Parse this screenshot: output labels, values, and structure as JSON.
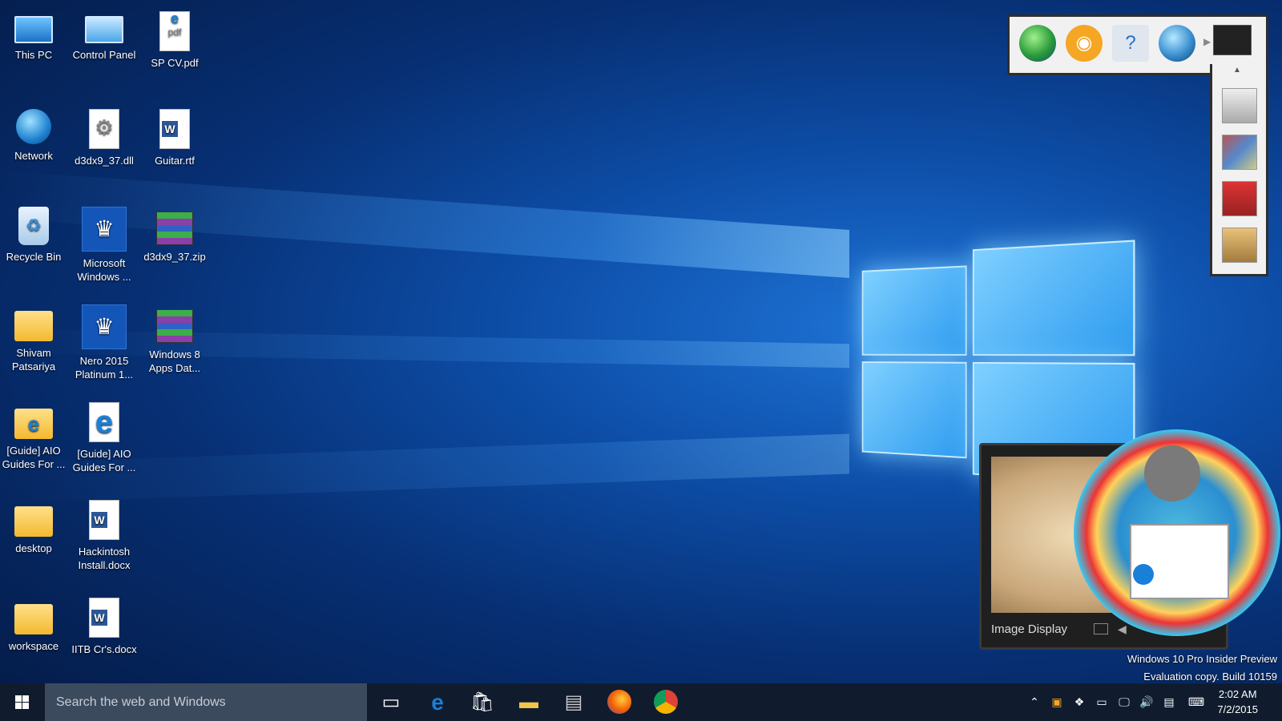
{
  "desktop": {
    "icons": [
      {
        "label": "This PC"
      },
      {
        "label": "Control Panel"
      },
      {
        "label": "SP CV.pdf"
      },
      {
        "label": "Network"
      },
      {
        "label": "d3dx9_37.dll"
      },
      {
        "label": "Guitar.rtf"
      },
      {
        "label": "Recycle Bin"
      },
      {
        "label": "Microsoft Windows ..."
      },
      {
        "label": "d3dx9_37.zip"
      },
      {
        "label": "Shivam Patsariya"
      },
      {
        "label": "Nero 2015 Platinum 1..."
      },
      {
        "label": "Windows 8 Apps Dat..."
      },
      {
        "label": "[Guide] AIO Guides For ..."
      },
      {
        "label": "[Guide] AIO Guides For ..."
      },
      {
        "label": "desktop"
      },
      {
        "label": "Hackintosh Install.docx"
      },
      {
        "label": "workspace"
      },
      {
        "label": "IITB Cr's.docx"
      }
    ]
  },
  "gadget": {
    "image_display_caption": "Image Display"
  },
  "watermark": {
    "line1": "Windows 10 Pro Insider Preview",
    "line2": "Evaluation copy. Build 10159"
  },
  "taskbar": {
    "search_placeholder": "Search the web and Windows",
    "time": "2:02 AM",
    "date": "7/2/2015"
  },
  "colors": {
    "taskbar": "#101c2e",
    "search_box": "#3c4a5e",
    "accent": "#1a7fd8"
  }
}
